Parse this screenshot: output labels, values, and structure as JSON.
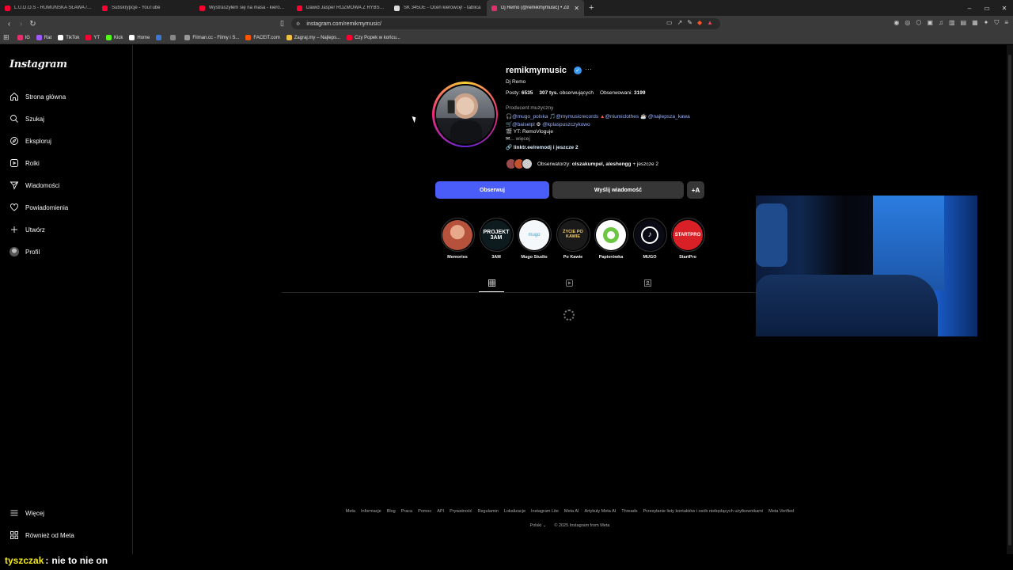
{
  "browser": {
    "tabs": [
      {
        "title": "L.U.D.O.S - RUMUŃSKA SŁAWA / DE",
        "favicon_color": "#ff0033",
        "active": false
      },
      {
        "title": "Subskrypcje - YouTube",
        "favicon_color": "#ff0033",
        "active": false
      },
      {
        "title": "Wystraszyłem się na masa - kierowca",
        "favicon_color": "#ff0033",
        "active": false
      },
      {
        "title": "Dawid Jasper ROZMOWA Z RYBSON",
        "favicon_color": "#ff0033",
        "active": false
      },
      {
        "title": "SK 345UE - Oceń kierowcę! - tablica",
        "favicon_color": "#dddddd",
        "active": false
      },
      {
        "title": "Dj Remo (@remikmymusic) • Zd",
        "favicon_color": "#e1306c",
        "active": true
      }
    ],
    "new_tab": "+",
    "window_controls": [
      "–",
      "▭",
      "✕"
    ],
    "url": "instagram.com/remikmymusic/",
    "bookmarks": [
      {
        "label": "IG",
        "color": "#e1306c"
      },
      {
        "label": "Rat",
        "color": "#a259ff"
      },
      {
        "label": "TikTok",
        "color": "#ffffff"
      },
      {
        "label": "YT",
        "color": "#ff0033"
      },
      {
        "label": "Kick",
        "color": "#53fc18"
      },
      {
        "label": "Home",
        "color": "#ffffff"
      },
      {
        "label": "",
        "color": "#3c78d8"
      },
      {
        "label": "",
        "color": "#888888"
      },
      {
        "label": "Filman.cc - Filmy i S...",
        "color": "#999999"
      },
      {
        "label": "FACEIT.com",
        "color": "#ff5500"
      },
      {
        "label": "Zagraj.my – Najleps...",
        "color": "#f0c040"
      },
      {
        "label": "Czy Popek w końcu...",
        "color": "#ff0033"
      }
    ]
  },
  "sidebar": {
    "logo": "Instagram",
    "items": [
      {
        "label": "Strona główna",
        "icon": "home-icon"
      },
      {
        "label": "Szukaj",
        "icon": "search-icon"
      },
      {
        "label": "Eksploruj",
        "icon": "compass-icon"
      },
      {
        "label": "Rolki",
        "icon": "reels-icon"
      },
      {
        "label": "Wiadomości",
        "icon": "send-icon"
      },
      {
        "label": "Powiadomienia",
        "icon": "heart-icon"
      },
      {
        "label": "Utwórz",
        "icon": "plus-icon"
      },
      {
        "label": "Profil",
        "icon": "avatar-icon"
      }
    ],
    "bottom_items": [
      {
        "label": "Więcej",
        "icon": "menu-icon"
      },
      {
        "label": "Również od Meta",
        "icon": "meta-icon"
      }
    ]
  },
  "profile": {
    "username": "remikmymusic",
    "verified": true,
    "full_name": "Dj Remo",
    "posts_label": "Posty:",
    "posts_value": "6535",
    "followers_value": "307 tys.",
    "followers_label": "obserwujących",
    "following_label": "Obserwowani:",
    "following_value": "3199",
    "category": "Producent muzyczny",
    "bio": {
      "line1_mentions": [
        "@mugo_polska",
        "@mymusicrecords",
        "@niumiclothes",
        "@najlepsza_kawa"
      ],
      "line2_mentions": [
        "@baiselpl",
        "@kplaspuszczykowo"
      ],
      "line3": "YT: RemoVloguje",
      "line4_more": "... więcej"
    },
    "link": "linktr.ee/remodj i jeszcze 2",
    "followed_by_prefix": "Obserwatorzy:",
    "followed_by_names": "olszakumpel, aleshengg",
    "followed_by_suffix": "+ jeszcze 2",
    "buttons": {
      "follow": "Obserwuj",
      "message": "Wyślij wiadomość",
      "suggest": "+A"
    },
    "highlights": [
      {
        "label": "Memories",
        "text": "",
        "bg": "#c0604a"
      },
      {
        "label": "3AM",
        "text": "PROJEKT 3AM",
        "bg": "#0d1a1e"
      },
      {
        "label": "Mugo Studio",
        "text": "mugo",
        "bg": "#f4f8fb"
      },
      {
        "label": "Po Kawie",
        "text": "ŻYCIE PO KAWIE",
        "bg": "#1a1a1a"
      },
      {
        "label": "Papierówka",
        "text": "",
        "bg": "#ffffff"
      },
      {
        "label": "MUGO",
        "text": "",
        "bg": "#0a0a14"
      },
      {
        "label": "StartPro",
        "text": "STARTPRO",
        "bg": "#d92027"
      }
    ]
  },
  "footer": {
    "links": [
      "Meta",
      "Informacje",
      "Blog",
      "Praca",
      "Pomoc",
      "API",
      "Prywatność",
      "Regulamin",
      "Lokalizacje",
      "Instagram Lite",
      "Meta AI",
      "Artykuły Meta AI",
      "Threads",
      "Przesyłanie listy kontaktów i osób niebędących użytkownikami",
      "Meta Verified"
    ],
    "language": "Polski",
    "copyright": "© 2025 Instagram from Meta"
  },
  "chat_overlay": {
    "user": "tyszczak",
    "separator": ":",
    "message": "nie to nie on"
  }
}
